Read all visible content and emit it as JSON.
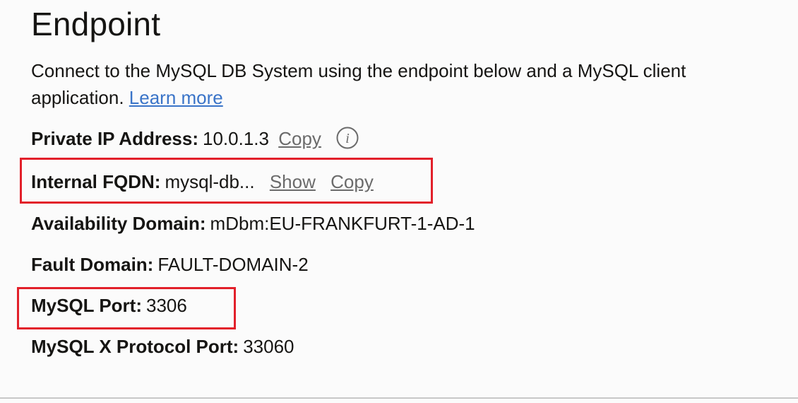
{
  "section": {
    "title": "Endpoint",
    "description": "Connect to the MySQL DB System using the endpoint below and a MySQL client application.",
    "learn_more": "Learn more"
  },
  "fields": {
    "private_ip": {
      "label": "Private IP Address:",
      "value": "10.0.1.3",
      "copy": "Copy",
      "icon": "info-icon"
    },
    "internal_fqdn": {
      "label": "Internal FQDN:",
      "value": "mysql-db...",
      "show": "Show",
      "copy": "Copy"
    },
    "availability_domain": {
      "label": "Availability Domain:",
      "value": "mDbm:EU-FRANKFURT-1-AD-1"
    },
    "fault_domain": {
      "label": "Fault Domain:",
      "value": "FAULT-DOMAIN-2"
    },
    "mysql_port": {
      "label": "MySQL Port:",
      "value": "3306"
    },
    "mysql_x_port": {
      "label": "MySQL X Protocol Port:",
      "value": "33060"
    }
  },
  "colors": {
    "highlight": "#e2202a",
    "link": "#3a74c8",
    "action_link": "#6b6b6b"
  }
}
